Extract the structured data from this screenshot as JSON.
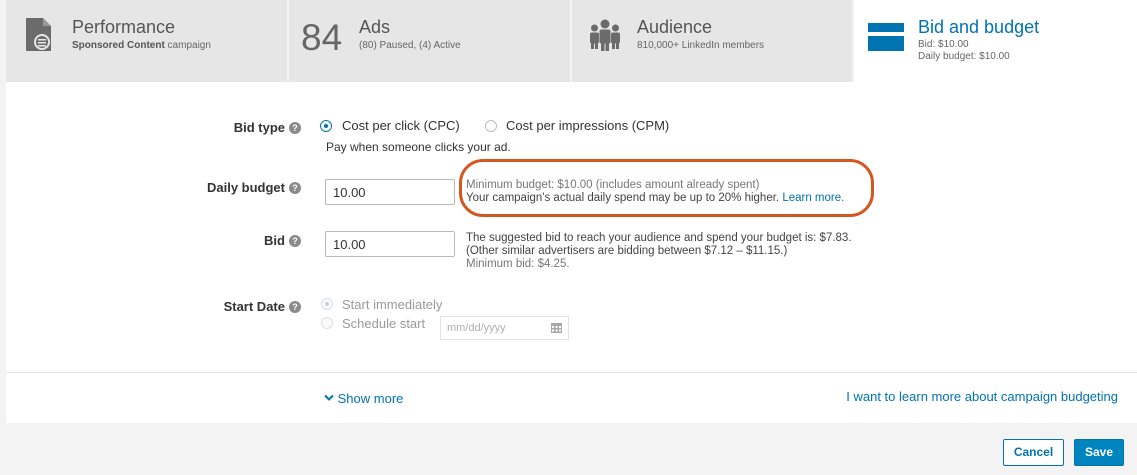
{
  "tabs": {
    "performance": {
      "title": "Performance",
      "sub_bold": "Sponsored Content",
      "sub_rest": " campaign"
    },
    "ads": {
      "count": "84",
      "title": "Ads",
      "sub": "(80) Paused,  (4) Active"
    },
    "audience": {
      "title": "Audience",
      "sub": "810,000+ LinkedIn members"
    },
    "bid_budget": {
      "title": "Bid and budget",
      "bid": "Bid:  $10.00",
      "daily": "Daily budget:  $10.00"
    }
  },
  "form": {
    "help_glyph": "?",
    "bid_type": {
      "label": "Bid type",
      "option_cpc": "Cost per click (CPC)",
      "option_cpm": "Cost per impressions (CPM)",
      "note": "Pay when someone clicks your ad.",
      "selected": "cpc"
    },
    "daily_budget": {
      "label": "Daily budget",
      "value": "10.00",
      "hint_line1": "Minimum budget: $10.00 (includes amount already spent)",
      "hint_line2": "Your campaign's actual daily spend may be up to 20% higher. ",
      "learn_more": "Learn more."
    },
    "bid": {
      "label": "Bid",
      "value": "10.00",
      "hint_line1": "The suggested bid to reach your audience and spend your budget is: $7.83.",
      "hint_line2": "(Other similar advertisers are bidding between $7.12 – $11.15.)",
      "hint_line3": "Minimum bid: $4.25."
    },
    "start_date": {
      "label": "Start Date",
      "option_immediate": "Start immediately",
      "option_schedule": "Schedule start",
      "date_placeholder": "mm/dd/yyyy"
    }
  },
  "footer": {
    "show_more": "Show more",
    "learn_budgeting": "I want to learn more about campaign budgeting",
    "cancel": "Cancel",
    "save": "Save"
  },
  "colors": {
    "accent": "#0073b1",
    "highlight": "#d4571f"
  }
}
